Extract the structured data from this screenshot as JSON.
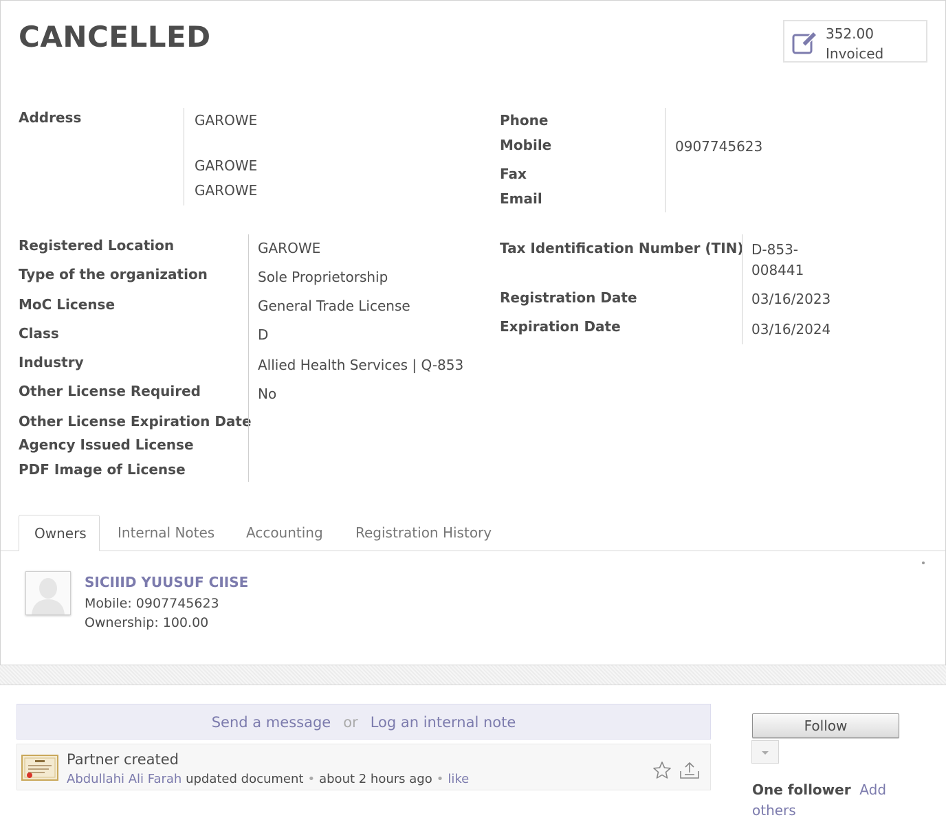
{
  "header": {
    "status_title": "CANCELLED",
    "stat_button": {
      "value": "352.00",
      "label": "Invoiced",
      "icon": "edit-pen-icon"
    }
  },
  "contact": {
    "address_label": "Address",
    "address_lines": [
      "GAROWE",
      "GAROWE",
      "GAROWE"
    ],
    "phone_label": "Phone",
    "mobile_label": "Mobile",
    "mobile_value": "0907745623",
    "fax_label": "Fax",
    "email_label": "Email"
  },
  "registration": {
    "registered_location": {
      "label": "Registered Location",
      "value": "GAROWE"
    },
    "org_type": {
      "label": "Type of the organization",
      "value": "Sole Proprietorship"
    },
    "moc_license": {
      "label": "MoC License",
      "value": "General Trade License"
    },
    "class": {
      "label": "Class",
      "value": "D"
    },
    "industry": {
      "label": "Industry",
      "value": "Allied Health Services | Q-853"
    },
    "other_license_required": {
      "label": "Other License Required",
      "value": "No"
    },
    "other_license_expiration": {
      "label": "Other License Expiration Date"
    },
    "agency_issued_license": {
      "label": "Agency Issued License"
    },
    "pdf_image": {
      "label": "PDF Image of License"
    },
    "tin": {
      "label": "Tax Identification Number (TIN)",
      "value_line1": "D-853-",
      "value_line2": "008441"
    },
    "registration_date": {
      "label": "Registration Date",
      "value": "03/16/2023"
    },
    "expiration_date": {
      "label": "Expiration Date",
      "value": "03/16/2024"
    }
  },
  "tabs": [
    {
      "label": "Owners",
      "active": true
    },
    {
      "label": "Internal Notes",
      "active": false
    },
    {
      "label": "Accounting",
      "active": false
    },
    {
      "label": "Registration History",
      "active": false
    }
  ],
  "owner": {
    "name": "SICIIID YUUSUF CIISE",
    "mobile": "Mobile: 0907745623",
    "ownership": "Ownership: 100.00"
  },
  "chatter": {
    "send_message": "Send a message",
    "or": "or",
    "log_note": "Log an internal note",
    "message": {
      "title": "Partner created",
      "author": "Abdullahi Ali Farah",
      "action": "updated document",
      "time": "about 2 hours ago",
      "like": "like"
    },
    "follow_label": "Follow",
    "follower_count": "One follower",
    "add_others": "Add others"
  },
  "colors": {
    "link": "#7c7bad",
    "text": "#4c4c4c"
  }
}
